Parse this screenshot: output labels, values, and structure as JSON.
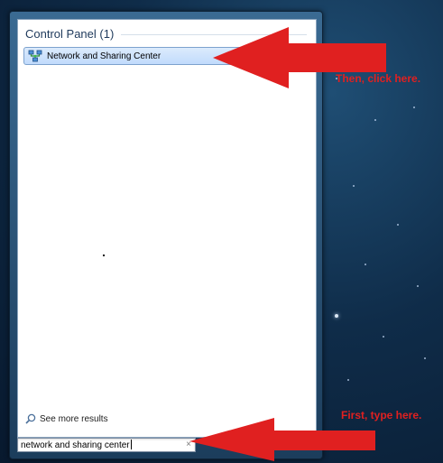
{
  "annotations": {
    "step2": "Then, click here.",
    "step1": "First, type here."
  },
  "start_menu": {
    "section_title": "Control Panel (1)",
    "result_item": {
      "label": "Network and Sharing Center",
      "icon": "network-sharing-icon"
    },
    "see_more": {
      "label": "See more results",
      "icon": "magnifier-icon"
    },
    "search": {
      "value": "network and sharing center",
      "clear_glyph": "×"
    }
  },
  "colors": {
    "annotation_red": "#e02020",
    "highlight": "#c1dbfc",
    "desktop": "#0f2c49"
  }
}
